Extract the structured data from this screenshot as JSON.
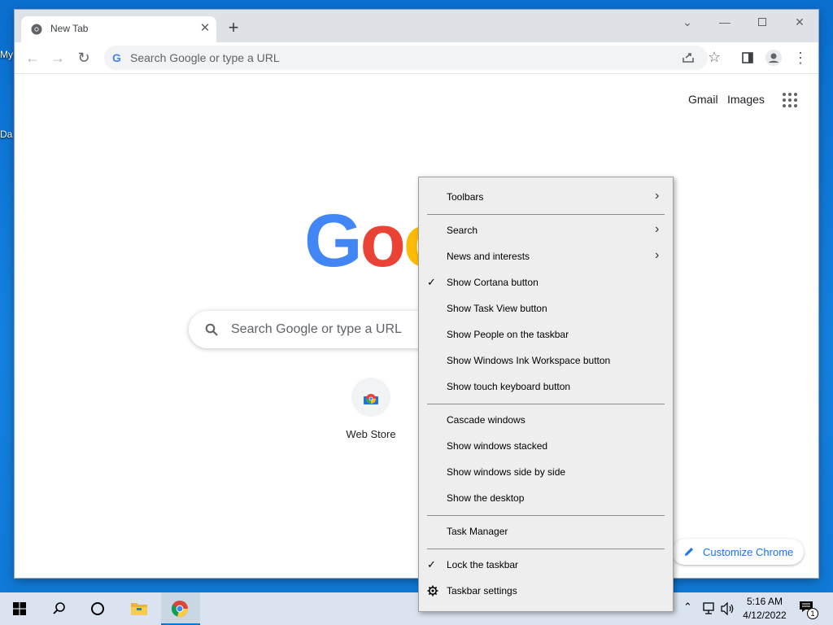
{
  "desktop": {
    "icon_labels": [
      "My",
      "Da"
    ]
  },
  "browser": {
    "tab_title": "New Tab",
    "omnibox_placeholder": "Search Google or type a URL",
    "ntp": {
      "gmail": "Gmail",
      "images": "Images",
      "logo_letters": [
        "G",
        "o",
        "o"
      ],
      "logo_colors": [
        "#4285f4",
        "#ea4335",
        "#fbbc05"
      ],
      "search_placeholder": "Search Google or type a URL",
      "shortcut_label": "Web Store",
      "customize_label": "Customize Chrome"
    }
  },
  "context_menu": {
    "items": [
      {
        "label": "Toolbars",
        "checked": false,
        "submenu": true
      },
      {
        "label": "Search",
        "checked": false,
        "submenu": true
      },
      {
        "label": "News and interests",
        "checked": false,
        "submenu": true
      },
      {
        "label": "Show Cortana button",
        "checked": true,
        "submenu": false
      },
      {
        "label": "Show Task View button",
        "checked": false,
        "submenu": false
      },
      {
        "label": "Show People on the taskbar",
        "checked": false,
        "submenu": false
      },
      {
        "label": "Show Windows Ink Workspace button",
        "checked": false,
        "submenu": false
      },
      {
        "label": "Show touch keyboard button",
        "checked": false,
        "submenu": false
      },
      {
        "label": "Cascade windows",
        "checked": false,
        "submenu": false
      },
      {
        "label": "Show windows stacked",
        "checked": false,
        "submenu": false
      },
      {
        "label": "Show windows side by side",
        "checked": false,
        "submenu": false
      },
      {
        "label": "Show the desktop",
        "checked": false,
        "submenu": false
      },
      {
        "label": "Task Manager",
        "checked": false,
        "submenu": false
      },
      {
        "label": "Lock the taskbar",
        "checked": true,
        "submenu": false
      },
      {
        "label": "Taskbar settings",
        "checked": false,
        "submenu": false,
        "icon": "gear-icon"
      }
    ],
    "check_glyph": "✓",
    "arrow_glyph": "›"
  },
  "taskbar": {
    "time": "5:16 AM",
    "date": "4/12/2022",
    "notification_count": "1",
    "accent": "#0078d7"
  }
}
